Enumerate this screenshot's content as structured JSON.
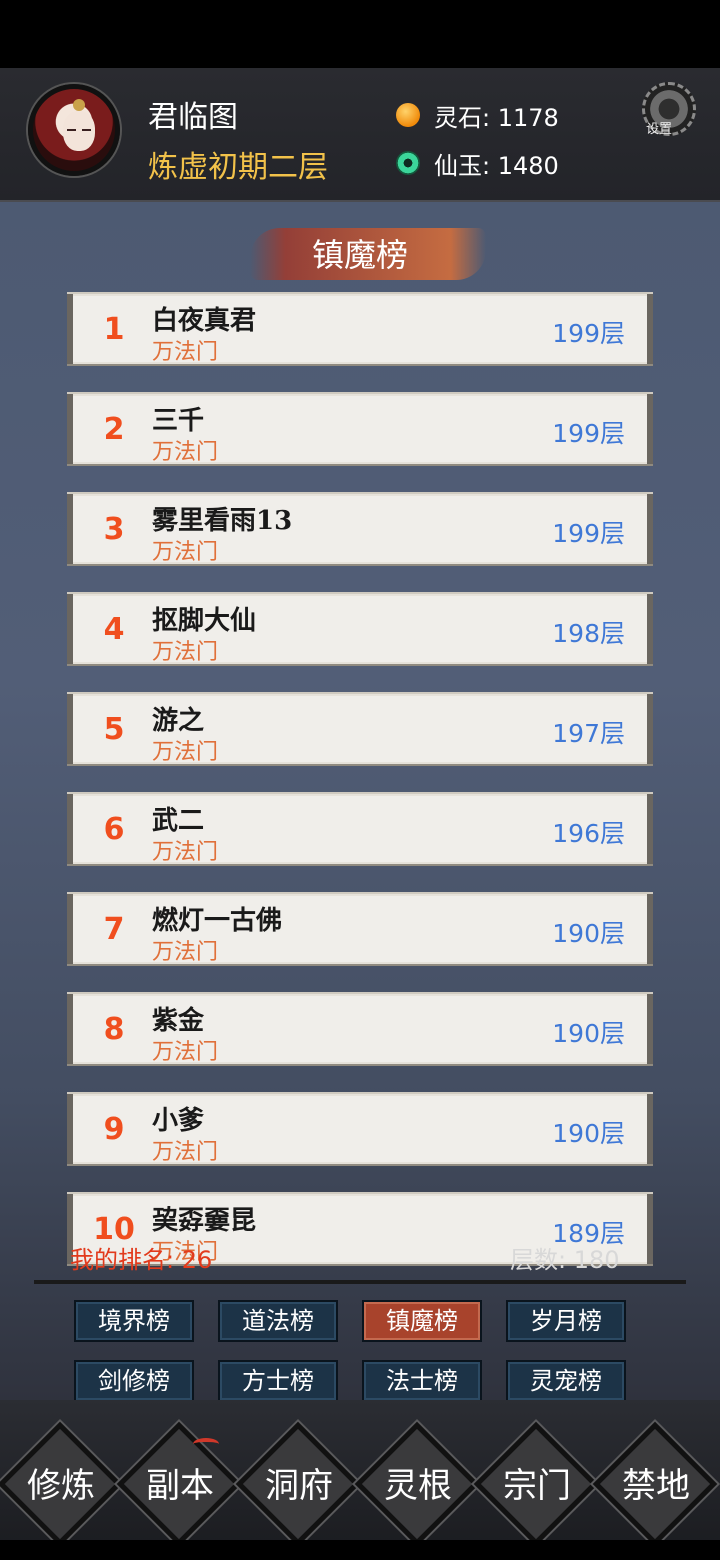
{
  "player": {
    "name": "君临图",
    "realm": "炼虚初期二层"
  },
  "resources": [
    {
      "label": "灵石: 1178",
      "icon": "spirit-stone-icon"
    },
    {
      "label": "仙玉: 1480",
      "icon": "immortal-jade-icon"
    }
  ],
  "settings_label": "设置",
  "board": {
    "title": "镇魔榜",
    "entries": [
      {
        "rank": "1",
        "name": "白夜真君",
        "sect": "万法门",
        "floor": "199层"
      },
      {
        "rank": "2",
        "name": "三千",
        "sect": "万法门",
        "floor": "199层"
      },
      {
        "rank": "3",
        "name": "雾里看雨13",
        "sect": "万法门",
        "floor": "199层"
      },
      {
        "rank": "4",
        "name": "抠脚大仙",
        "sect": "万法门",
        "floor": "198层"
      },
      {
        "rank": "5",
        "name": "游之",
        "sect": "万法门",
        "floor": "197层"
      },
      {
        "rank": "6",
        "name": "武二",
        "sect": "万法门",
        "floor": "196层"
      },
      {
        "rank": "7",
        "name": "燃灯一古佛",
        "sect": "万法门",
        "floor": "190层"
      },
      {
        "rank": "8",
        "name": "紫金",
        "sect": "万法门",
        "floor": "190层"
      },
      {
        "rank": "9",
        "name": "小爹",
        "sect": "万法门",
        "floor": "190层"
      },
      {
        "rank": "10",
        "name": "巭孬嫑昆",
        "sect": "万法门",
        "floor": "189层"
      }
    ],
    "my_rank": "我的排名: 26",
    "my_floor": "层数: 180"
  },
  "tabs": [
    {
      "label": "境界榜",
      "active": false
    },
    {
      "label": "道法榜",
      "active": false
    },
    {
      "label": "镇魔榜",
      "active": true
    },
    {
      "label": "岁月榜",
      "active": false
    },
    {
      "label": "剑修榜",
      "active": false
    },
    {
      "label": "方士榜",
      "active": false
    },
    {
      "label": "法士榜",
      "active": false
    },
    {
      "label": "灵宠榜",
      "active": false
    }
  ],
  "nav": [
    "修炼",
    "副本",
    "洞府",
    "灵根",
    "宗门",
    "禁地"
  ],
  "colors": {
    "accent_rank": "#f04e1e",
    "floor_text": "#3f78d6",
    "sect_text": "#e0703a",
    "realm_text": "#f2c24a",
    "active_tab": "#a8432c"
  }
}
